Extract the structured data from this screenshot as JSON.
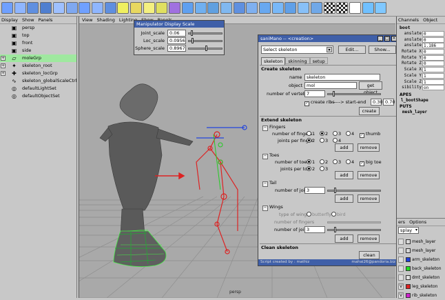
{
  "toolbar": {
    "icons": [
      "sphere-icon",
      "cube-icon",
      "cylinder-icon",
      "cone-icon",
      "plane-icon",
      "torus-icon",
      "subdiv-sphere-icon",
      "subdiv-cube-icon",
      "subdiv-cylinder-icon",
      "spotlight-icon",
      "directional-light-icon",
      "point-light-icon",
      "ambient-light-icon",
      "hypershade-icon",
      "bevel-icon",
      "extrude-icon",
      "smooth-icon",
      "bridge-icon",
      "split-icon",
      "wedge-icon",
      "merge-icon",
      "chamfer-icon",
      "reduce-icon",
      "cleanup-icon",
      "mirror-icon",
      "checker-icon",
      "checker-sel-icon",
      "cursor-tool-icon",
      "render-icon",
      "ipr-icon"
    ]
  },
  "outliner": {
    "menu": [
      "Display",
      "Show",
      "Panels"
    ],
    "items": [
      {
        "label": "persp",
        "icon": "camera-icon",
        "exp": false,
        "sel": false
      },
      {
        "label": "top",
        "icon": "camera-icon",
        "exp": false,
        "sel": false
      },
      {
        "label": "front",
        "icon": "camera-icon",
        "exp": false,
        "sel": false
      },
      {
        "label": "side",
        "icon": "camera-icon",
        "exp": false,
        "sel": false
      },
      {
        "label": "moleGrp",
        "icon": "group-icon",
        "exp": true,
        "sel": true
      },
      {
        "label": "skeleton_root",
        "icon": "joint-icon",
        "exp": true,
        "sel": false
      },
      {
        "label": "skeleton_locGrp",
        "icon": "locator-icon",
        "exp": true,
        "sel": false
      },
      {
        "label": "skeleton_globalScaleCtrl",
        "icon": "curve-icon",
        "exp": false,
        "sel": false
      },
      {
        "label": "defaultLightSet",
        "icon": "set-icon",
        "exp": false,
        "sel": false
      },
      {
        "label": "defaultObjectSet",
        "icon": "set-icon",
        "exp": false,
        "sel": false
      }
    ]
  },
  "viewport": {
    "menu": [
      "View",
      "Shading",
      "Lighting",
      "Show",
      "Panels"
    ],
    "label": "persp"
  },
  "manip": {
    "title": "Manipulator Display Scale",
    "rows": [
      {
        "label": "Joint_scale",
        "value": "0.06",
        "frac": 0.08
      },
      {
        "label": "Loc_scale",
        "value": "0.0956",
        "frac": 0.11
      },
      {
        "label": "Sphere_scale",
        "value": "0.8967",
        "frac": 0.55
      }
    ]
  },
  "sani": {
    "title": "saniMano -- <creation>",
    "select_placeholder": "Select skeleton",
    "edit": "Edit...",
    "show": "Show...",
    "tabs": [
      "skeleton",
      "skinning",
      "setup"
    ],
    "create_header": "Create skeleton",
    "name_label": "name",
    "name_value": "skeleton",
    "object_label": "object",
    "object_value": "mol",
    "get_object": "get object",
    "vert_label": "number of vertebras",
    "vert_value": "7",
    "ribs_label": "create ribs",
    "ribs_arrow": "------> start-end",
    "ribs_start": "0.30",
    "ribs_end": "0.70",
    "create_btn": "create",
    "extend_header": "Extend skeleton",
    "fingers": {
      "title": "Fingers",
      "num_label": "number of fingers",
      "num_opts": [
        "1",
        "2",
        "3",
        "4"
      ],
      "num_sel": 1,
      "thumb": "thumb",
      "joints_label": "joints per finger",
      "joint_opts": [
        "2",
        "3",
        "4"
      ],
      "joint_sel": 0
    },
    "toes": {
      "title": "Toes",
      "num_label": "number of toes",
      "num_opts": [
        "1",
        "2",
        "3",
        "4"
      ],
      "num_sel": 0,
      "bigtoe": "big toe",
      "joints_label": "joints per toe",
      "joint_opts": [
        "2",
        "3"
      ],
      "joint_sel": 0
    },
    "tail": {
      "title": "Tail",
      "num_label": "number of joints",
      "value": "3"
    },
    "wings": {
      "title": "Wings",
      "type_label": "type of wings",
      "type_opts": [
        "butterfly",
        "bird"
      ],
      "fingers_label": "number of fingers",
      "joints_label": "number of joints",
      "value": "3"
    },
    "add": "add",
    "remove": "remove",
    "clean_header": "Clean skeleton",
    "clean_btn": "clean",
    "status_left": "Script created by  : mathiz",
    "status_right": "mahai26@pandoria.biz"
  },
  "channels": {
    "tabs": [
      "Channels",
      "Object"
    ],
    "node": "boot",
    "rows": [
      {
        "label": "anslate",
        "value": "0"
      },
      {
        "label": "anslate",
        "value": "0"
      },
      {
        "label": "anslate",
        "value": "1.186"
      },
      {
        "label": "Rotate X",
        "value": "0"
      },
      {
        "label": "Rotate Y",
        "value": "0"
      },
      {
        "label": "Rotate Z",
        "value": "0"
      },
      {
        "label": "Scale X",
        "value": "1"
      },
      {
        "label": "Scale Y",
        "value": "1"
      },
      {
        "label": "Scale Z",
        "value": "1"
      },
      {
        "label": "sibility",
        "value": "on"
      }
    ],
    "shapes_header": "APES",
    "shape": "l_bootShape",
    "inputs_header": "PUTS",
    "input": "mesh_layer"
  },
  "layers": {
    "tabs": [
      "ers",
      "Options"
    ],
    "dropdown": "splay",
    "items": [
      {
        "name": "mesh_layer",
        "v": "",
        "color": "#d8d8d8"
      },
      {
        "name": "mesh_layer",
        "v": "",
        "color": "#d8d8d8"
      },
      {
        "name": "arm_skeleton",
        "v": "",
        "color": "#1f3fd8"
      },
      {
        "name": "back_skeleton",
        "v": "",
        "color": "#22dd22"
      },
      {
        "name": "dmt_skeleton",
        "v": "",
        "color": "#e0e0e0"
      },
      {
        "name": "leg_skeleton",
        "v": "V",
        "color": "#dd2222"
      },
      {
        "name": "rib_skeleton",
        "v": "V",
        "color": "#cc22cc"
      }
    ]
  }
}
